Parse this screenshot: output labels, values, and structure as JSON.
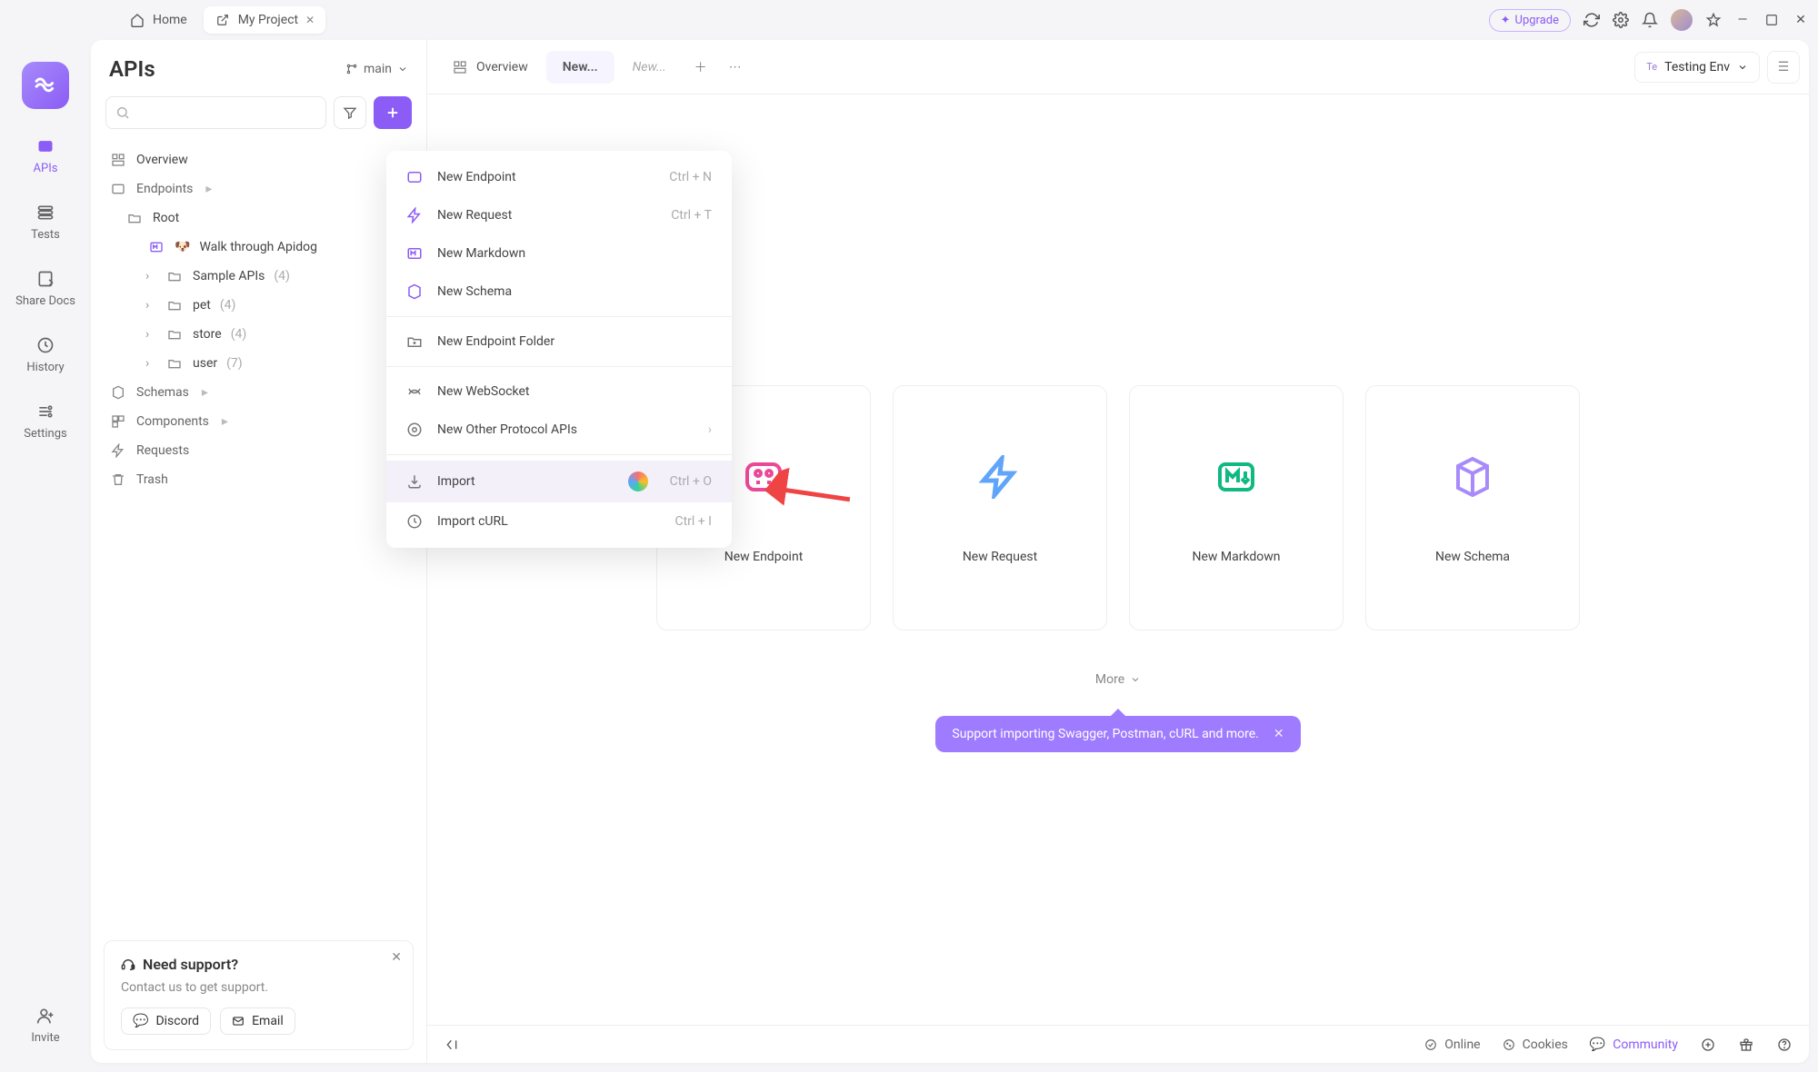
{
  "titlebar": {
    "home": "Home",
    "project_tab": "My Project",
    "upgrade": "Upgrade"
  },
  "rail": {
    "items": [
      "APIs",
      "Tests",
      "Share Docs",
      "History",
      "Settings"
    ],
    "invite": "Invite"
  },
  "sidebar": {
    "title": "APIs",
    "branch": "main",
    "tree": {
      "overview": "Overview",
      "endpoints": "Endpoints",
      "root": "Root",
      "walk": "Walk through Apidog",
      "folders": [
        {
          "label": "Sample APIs",
          "count": "(4)"
        },
        {
          "label": "pet",
          "count": "(4)"
        },
        {
          "label": "store",
          "count": "(4)"
        },
        {
          "label": "user",
          "count": "(7)"
        }
      ],
      "schemas": "Schemas",
      "components": "Components",
      "requests": "Requests",
      "trash": "Trash"
    }
  },
  "support": {
    "title": "Need support?",
    "sub": "Contact us to get support.",
    "discord": "Discord",
    "email": "Email"
  },
  "tabs": {
    "overview": "Overview",
    "new_active": "New...",
    "new_placeholder": "New...",
    "env_badge": "Te",
    "env_label": "Testing Env"
  },
  "cards": [
    "New Endpoint",
    "New Request",
    "New Markdown",
    "New Schema"
  ],
  "more": "More",
  "tooltip": "Support importing Swagger, Postman, cURL and more.",
  "dropdown": [
    {
      "label": "New Endpoint",
      "kbd": "Ctrl + N",
      "icon": "ep"
    },
    {
      "label": "New Request",
      "kbd": "Ctrl + T",
      "icon": "rq"
    },
    {
      "label": "New Markdown",
      "kbd": "",
      "icon": "md"
    },
    {
      "label": "New Schema",
      "kbd": "",
      "icon": "sc"
    },
    {
      "sep": true
    },
    {
      "label": "New Endpoint Folder",
      "icon": "fd",
      "gray": true
    },
    {
      "sep": true
    },
    {
      "label": "New WebSocket",
      "icon": "ws",
      "gray": true
    },
    {
      "label": "New Other Protocol APIs",
      "icon": "op",
      "gray": true,
      "chev": true
    },
    {
      "sep": true
    },
    {
      "label": "Import",
      "kbd": "Ctrl + O",
      "icon": "im",
      "gray": true,
      "hover": true,
      "palette": true
    },
    {
      "label": "Import cURL",
      "kbd": "Ctrl + I",
      "icon": "ic",
      "gray": true
    }
  ],
  "statusbar": {
    "online": "Online",
    "cookies": "Cookies",
    "community": "Community"
  }
}
